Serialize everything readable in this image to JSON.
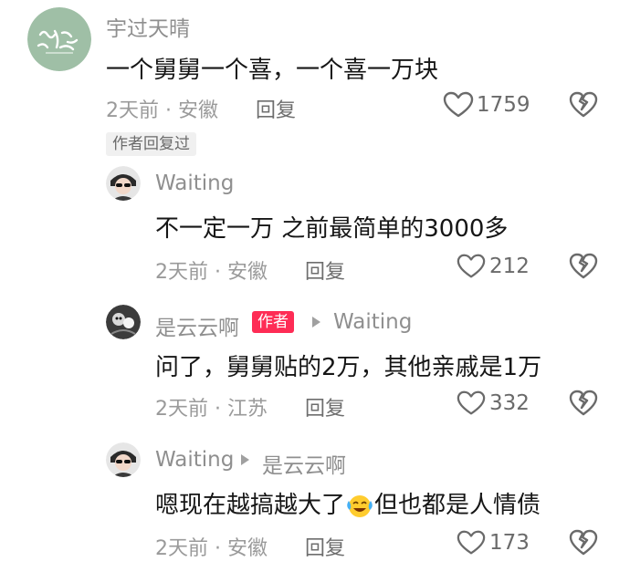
{
  "main_comment": {
    "username": "宇过天晴",
    "text": "一个舅舅一个喜，一个喜一万块",
    "time_location": "2天前 · 安徽",
    "reply_label": "回复",
    "likes": "1759",
    "author_replied_tag": "作者回复过"
  },
  "replies": [
    {
      "username": "Waiting",
      "text": "不一定一万 之前最简单的3000多",
      "time_location": "2天前 · 安徽",
      "reply_label": "回复",
      "likes": "212"
    },
    {
      "username": "是云云啊",
      "author_badge": "作者",
      "reply_to": "Waiting",
      "text": "问了，舅舅贴的2万，其他亲戚是1万",
      "time_location": "2天前 · 江苏",
      "reply_label": "回复",
      "likes": "332"
    },
    {
      "username": "Waiting",
      "reply_to": "是云云啊",
      "text_before_emoji": "嗯现在越搞越大了",
      "emoji": "laughing-crying-emoji",
      "text_after_emoji": "但也都是人情债",
      "time_location": "2天前 · 安徽",
      "reply_label": "回复",
      "likes": "173"
    }
  ],
  "icons": {
    "like": "heart-outline-icon",
    "dislike": "broken-heart-icon"
  }
}
